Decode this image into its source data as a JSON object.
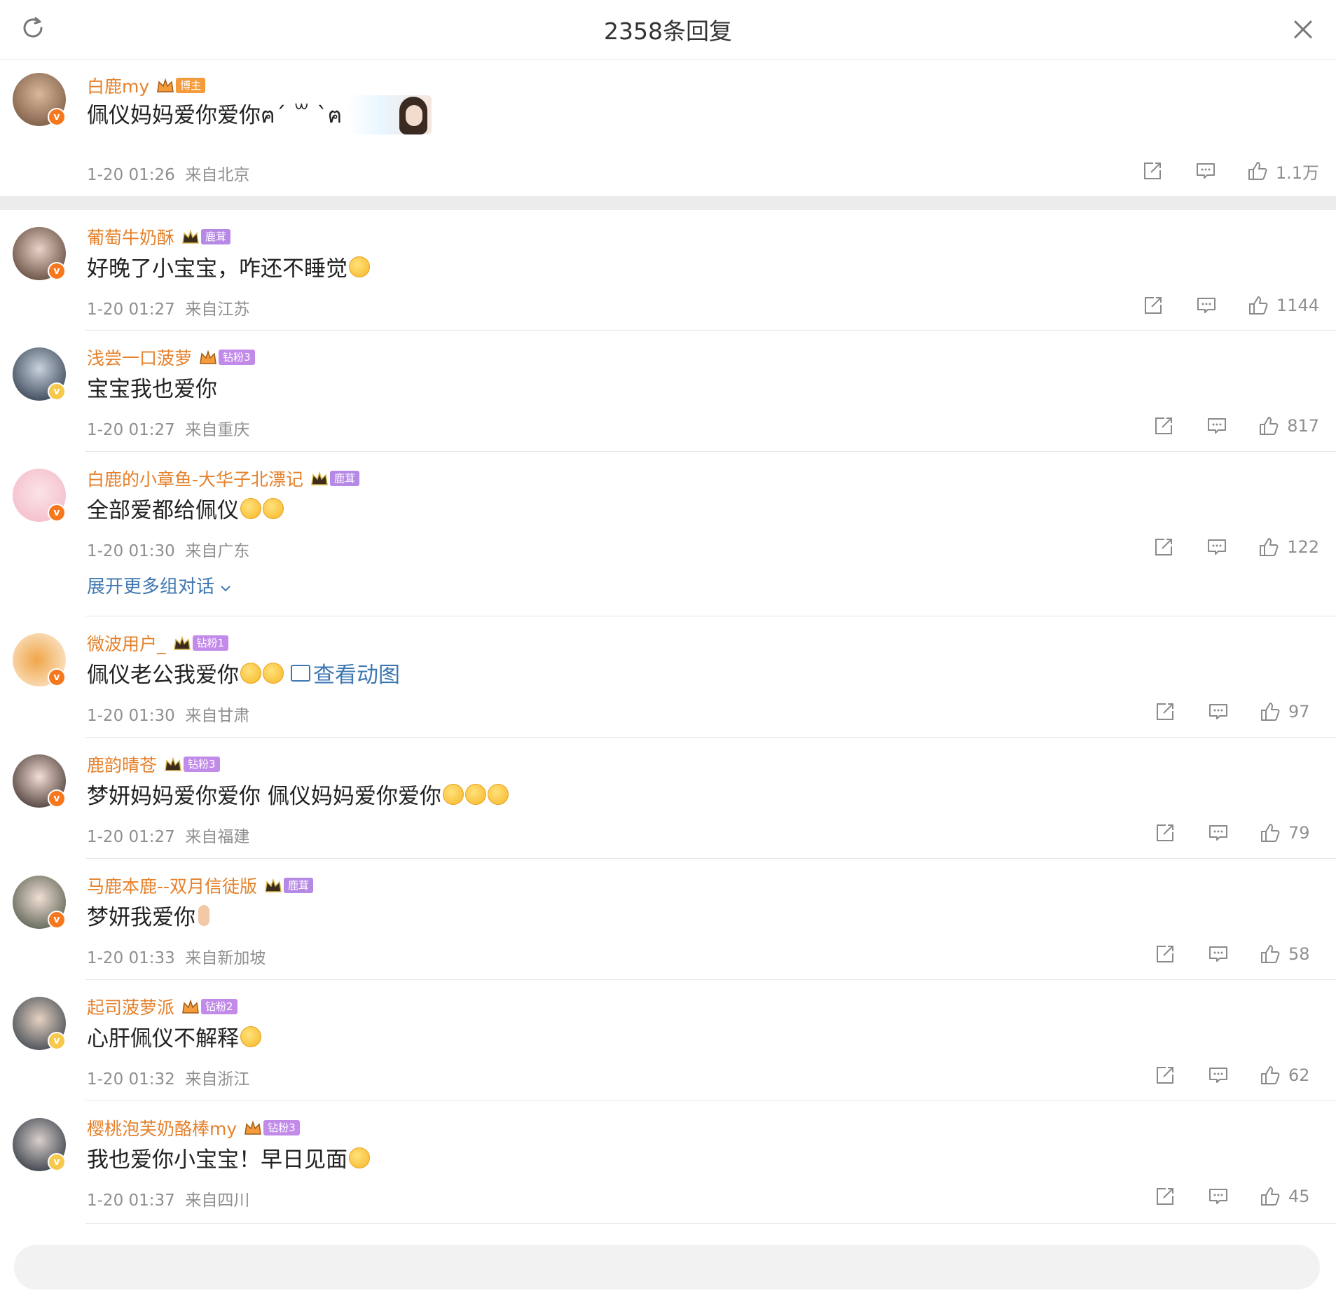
{
  "header": {
    "title": "2358条回复"
  },
  "main_comment": {
    "user": "白鹿my",
    "tag": "博主",
    "text": "佩仪妈妈爱你爱你ฅ´ ꒳ `ฅ",
    "time": "1-20 01:26",
    "location": "来自北京",
    "likes": "1.1万"
  },
  "replies": [
    {
      "user": "葡萄牛奶酥",
      "tag": "鹿茸",
      "text": "好晚了小宝宝，咋还不睡觉",
      "time": "1-20 01:27",
      "location": "来自江苏",
      "likes": "1144"
    },
    {
      "user": "浅尝一口菠萝",
      "tag": "钻粉3",
      "text": "宝宝我也爱你",
      "time": "1-20 01:27",
      "location": "来自重庆",
      "likes": "817"
    },
    {
      "user": "白鹿的小章鱼-大华子北漂记",
      "tag": "鹿茸",
      "text": "全部爱都给佩仪",
      "time": "1-20 01:30",
      "location": "来自广东",
      "likes": "122",
      "expand": "展开更多组对话"
    },
    {
      "user": "微波用户_",
      "tag": "钻粉1",
      "text": "佩仪老公我爱你",
      "link": "查看动图",
      "time": "1-20 01:30",
      "location": "来自甘肃",
      "likes": "97"
    },
    {
      "user": "鹿韵晴苍",
      "tag": "钻粉3",
      "text": "梦妍妈妈爱你爱你 佩仪妈妈爱你爱你",
      "time": "1-20 01:27",
      "location": "来自福建",
      "likes": "79"
    },
    {
      "user": "马鹿本鹿--双月信徒版",
      "tag": "鹿茸",
      "text": "梦妍我爱你",
      "time": "1-20 01:33",
      "location": "来自新加坡",
      "likes": "58"
    },
    {
      "user": "起司菠萝派",
      "tag": "钻粉2",
      "text": "心肝佩仪不解释",
      "time": "1-20 01:32",
      "location": "来自浙江",
      "likes": "62"
    },
    {
      "user": "樱桃泡芙奶酪棒my",
      "tag": "钻粉3",
      "text": "我也爱你小宝宝！早日见面",
      "time": "1-20 01:37",
      "location": "来自四川",
      "likes": "45"
    }
  ],
  "icons": {
    "refresh": "refresh-icon",
    "close": "close-icon",
    "share": "share-icon",
    "comment": "comment-icon",
    "like": "thumbs-up-icon",
    "verified": "verified-v-icon",
    "crown": "crown-icon"
  },
  "colors": {
    "username": "#e5812b",
    "link": "#3e77b0",
    "meta": "#8f8f8f",
    "verified_orange": "#f7771d",
    "verified_gold": "#f6c94a"
  }
}
